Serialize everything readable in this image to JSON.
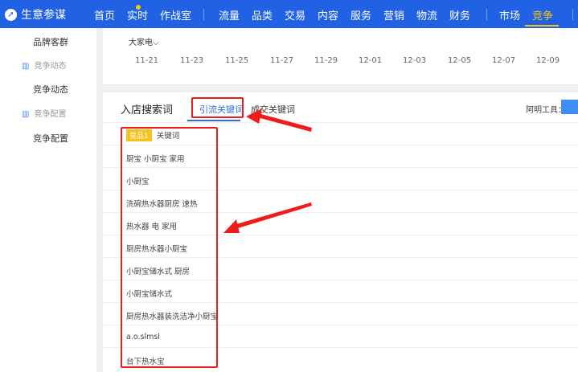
{
  "header": {
    "brand": "生意参谋",
    "nav": [
      "首页",
      "实时",
      "作战室",
      "流量",
      "品类",
      "交易",
      "内容",
      "服务",
      "营销",
      "物流",
      "财务",
      "市场",
      "竞争"
    ],
    "active": "竞争"
  },
  "sidebar": {
    "items": [
      {
        "label": "品牌客群"
      },
      {
        "label": "竞争动态",
        "group": true
      },
      {
        "label": "竞争动态"
      },
      {
        "label": "竞争配置",
        "group": true
      },
      {
        "label": "竞争配置"
      }
    ]
  },
  "top_panel": {
    "dropdown": "大家电",
    "dates": [
      "11-21",
      "11-23",
      "11-25",
      "11-27",
      "11-29",
      "12-01",
      "12-03",
      "12-05",
      "12-07",
      "12-09"
    ]
  },
  "search_panel": {
    "title": "入店搜索词",
    "tabs": [
      "引流关键词",
      "成交关键词"
    ],
    "active_tab": "引流关键词",
    "tool_label": "阿明工具：",
    "badge": "竞品1",
    "column": "关键词",
    "keywords": [
      "厨宝 小厨宝 家用",
      "小厨宝",
      "洗碗热水器厨房 速热",
      "热水器 电 家用",
      "厨房热水器小厨宝",
      "小厨宝储水式 厨房",
      "小厨宝储水式",
      "厨房热水器装洗洁净小厨宝",
      "a.o.slmsl",
      "台下热水宝"
    ]
  },
  "colors": {
    "header": "#2062e3",
    "active": "#f5c518",
    "annotation": "#f01c1c",
    "tab_active": "#2b6fe0"
  }
}
